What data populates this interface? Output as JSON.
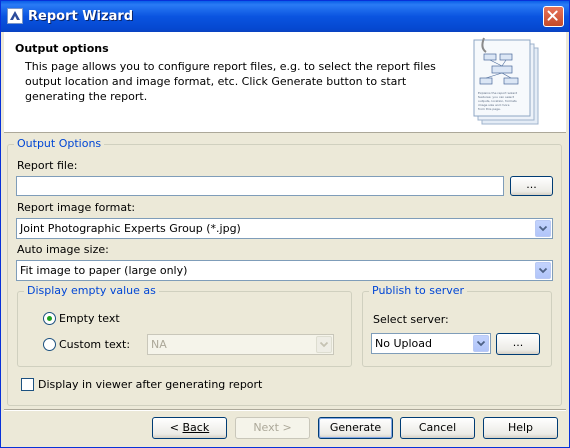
{
  "window": {
    "title": "Report Wizard"
  },
  "header": {
    "title": "Output options",
    "description": "This page allows you to configure report files, e.g. to select the report files output location and image format, etc. Click Generate button to start generating the report.",
    "image_caption_lines": [
      "Explains the report wizard",
      "features: you can select",
      "outputs, location, formats",
      "image size and more",
      "from this page."
    ]
  },
  "output_options": {
    "legend": "Output Options",
    "report_file_label": "Report file:",
    "report_file_value": "",
    "browse_label": "...",
    "image_format_label": "Report image format:",
    "image_format_value": "Joint Photographic Experts Group (*.jpg)",
    "auto_size_label": "Auto image size:",
    "auto_size_value": "Fit image to paper (large only)"
  },
  "empty_value": {
    "legend": "Display empty value as",
    "empty_text_label": "Empty text",
    "custom_text_label": "Custom text:",
    "custom_text_value": "NA",
    "selected": "empty_text"
  },
  "publish": {
    "legend": "Publish to server",
    "select_server_label": "Select server:",
    "server_value": "No Upload",
    "browse_label": "..."
  },
  "display_in_viewer": {
    "label": "Display in viewer after generating report",
    "checked": false
  },
  "buttons": {
    "back": "Back",
    "next": "Next >",
    "generate": "Generate",
    "cancel": "Cancel",
    "help": "Help"
  },
  "colors": {
    "titlebar": "#0a54e0",
    "legend": "#0046d5",
    "dialog_bg": "#ece9d8"
  },
  "icons": [
    "app-icon",
    "close-icon",
    "report-document-icon",
    "combo-arrow-icon"
  ]
}
